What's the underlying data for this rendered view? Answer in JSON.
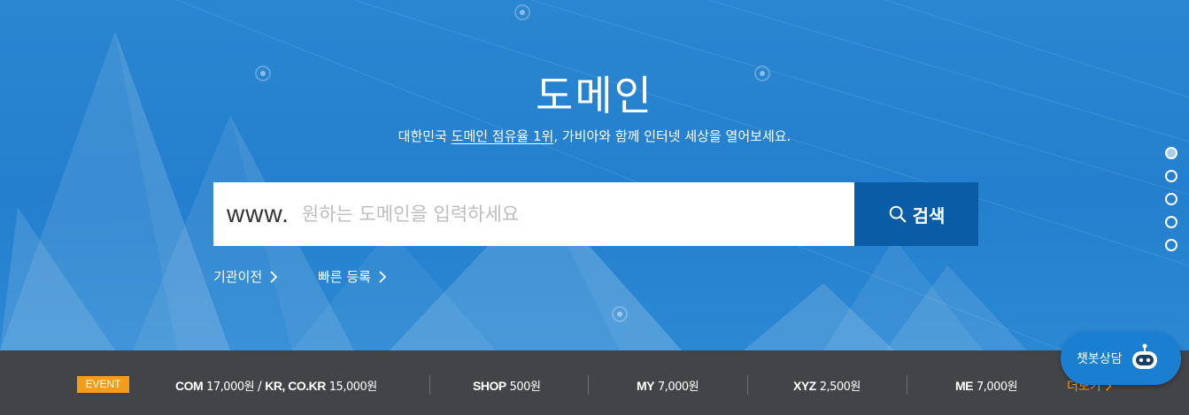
{
  "hero": {
    "title": "도메인",
    "subtitle_pre": "대한민국 ",
    "subtitle_highlight": "도메인 점유율 1위",
    "subtitle_post": ", 가비아와 함께 인터넷 세상을 열어보세요."
  },
  "search": {
    "prefix": "www.",
    "placeholder": "원하는 도메인을 입력하세요",
    "value": "",
    "button_label": "검색"
  },
  "quick_links": [
    {
      "label": "기관이전"
    },
    {
      "label": "빠른 등록"
    }
  ],
  "pager": {
    "count": 5,
    "active_index": 0
  },
  "event_bar": {
    "badge": "EVENT",
    "items": [
      {
        "tld": "COM",
        "price": "17,000원",
        "sep": " / ",
        "tld2": "KR, CO.KR",
        "price2": "15,000원"
      },
      {
        "tld": "SHOP",
        "price": "500원"
      },
      {
        "tld": "MY",
        "price": "7,000원"
      },
      {
        "tld": "XYZ",
        "price": "2,500원"
      },
      {
        "tld": "ME",
        "price": "7,000원"
      }
    ],
    "more_label": "더보기"
  },
  "chatbot": {
    "label": "챗봇상담"
  },
  "colors": {
    "hero_bg": "#2681cc",
    "search_button": "#0b5ca7",
    "event_bar": "#434447",
    "accent_orange": "#f39c1a",
    "chatbot": "#1a7fd1"
  }
}
